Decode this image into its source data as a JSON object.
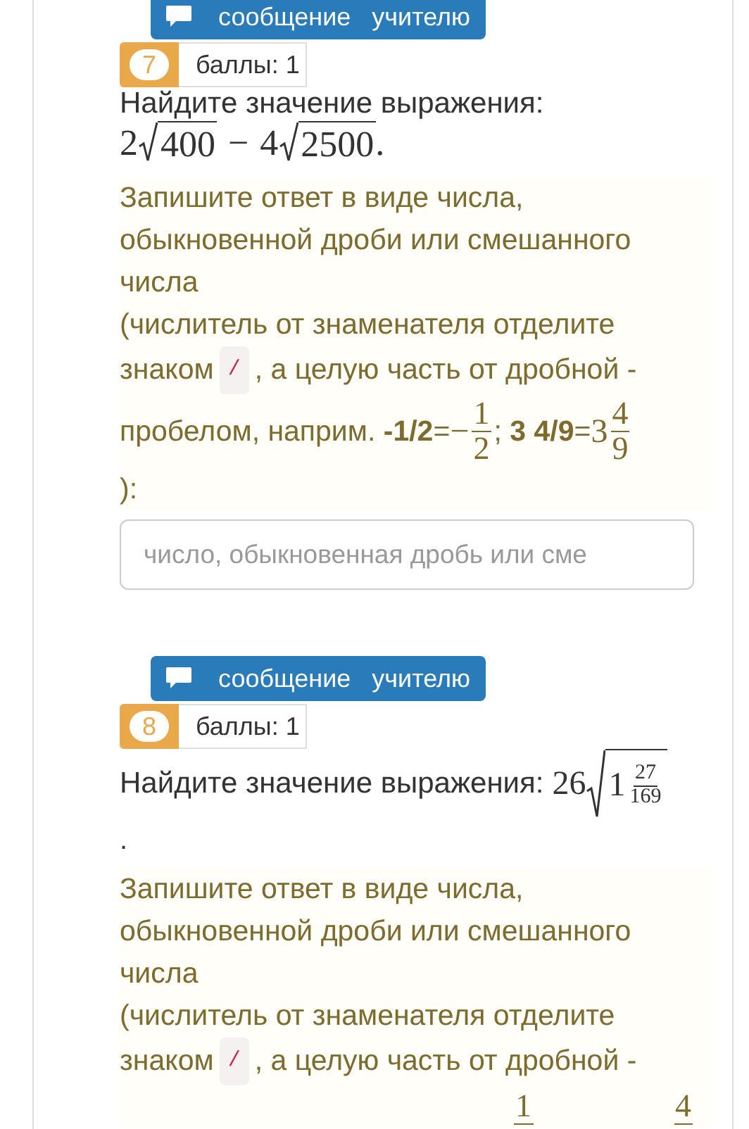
{
  "problems": [
    {
      "message_button": "сообщение учителю",
      "number": "7",
      "points": "баллы: 1",
      "prompt": "Найдите значение выражения:",
      "expression_inline": false,
      "expression": [
        {
          "kind": "num",
          "text": "2"
        },
        {
          "kind": "sqrt",
          "items": [
            {
              "kind": "num",
              "text": "400"
            }
          ]
        },
        {
          "kind": "op",
          "text": "−"
        },
        {
          "kind": "num",
          "text": "4"
        },
        {
          "kind": "sqrt",
          "items": [
            {
              "kind": "num",
              "text": "2500"
            }
          ]
        },
        {
          "kind": "num",
          "text": "."
        }
      ],
      "hint_lines": [
        [
          {
            "kind": "text",
            "text": "Запишите ответ в виде числа,"
          }
        ],
        [
          {
            "kind": "text",
            "text": "обыкновенной дроби или смешанного"
          }
        ],
        [
          {
            "kind": "text",
            "text": "числа"
          }
        ],
        [
          {
            "kind": "text",
            "text": "(числитель от знаменателя отделите"
          }
        ],
        [
          {
            "kind": "text",
            "text": "знаком"
          },
          {
            "kind": "code",
            "text": "/"
          },
          {
            "kind": "text",
            "text": ", а целую часть от дробной -"
          }
        ],
        [
          {
            "kind": "text",
            "text": "пробелом, наприм. **-1/2**="
          },
          {
            "kind": "frac",
            "sign": "−",
            "num": "1",
            "den": "2"
          },
          {
            "kind": "text",
            "text": "; **3 4/9**="
          },
          {
            "kind": "frac",
            "whole": "3",
            "num": "4",
            "den": "9"
          }
        ],
        [
          {
            "kind": "text",
            "text": "):"
          }
        ]
      ],
      "placeholder": "число, обыкновенная дробь или сме"
    },
    {
      "message_button": "сообщение учителю",
      "number": "8",
      "points": "баллы: 1",
      "prompt": "Найдите значение выражения:",
      "expression_inline": true,
      "expression": [
        {
          "kind": "num",
          "text": "26"
        },
        {
          "kind": "sqrt",
          "items": [
            {
              "kind": "frac",
              "whole": "1",
              "num": "27",
              "den": "169"
            }
          ]
        }
      ],
      "tail": ".",
      "hint_lines": [
        [
          {
            "kind": "text",
            "text": "Запишите ответ в виде числа,"
          }
        ],
        [
          {
            "kind": "text",
            "text": "обыкновенной дроби или смешанного"
          }
        ],
        [
          {
            "kind": "text",
            "text": "числа"
          }
        ],
        [
          {
            "kind": "text",
            "text": "(числитель от знаменателя отделите"
          }
        ],
        [
          {
            "kind": "text",
            "text": "знаком"
          },
          {
            "kind": "code",
            "text": "/"
          },
          {
            "kind": "text",
            "text": ", а целую часть от дробной -"
          }
        ],
        [
          {
            "kind": "frac_top",
            "num": "1"
          },
          {
            "kind": "frac_top",
            "num": "4"
          }
        ]
      ]
    }
  ]
}
